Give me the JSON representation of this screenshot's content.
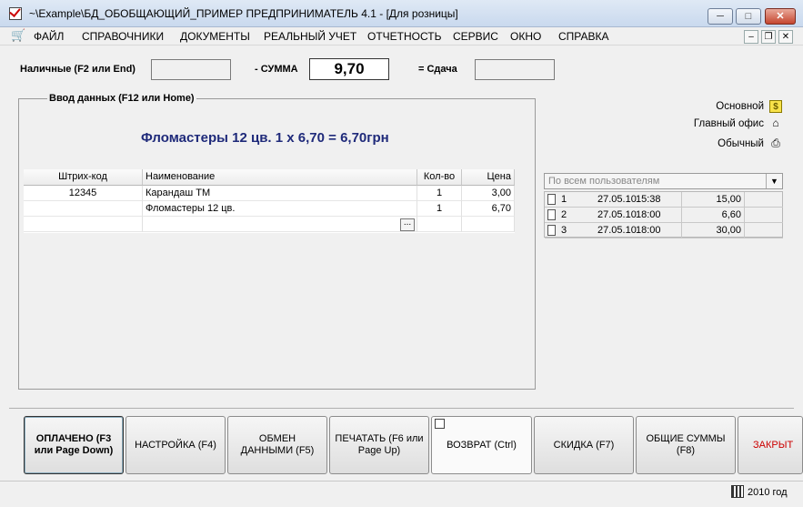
{
  "window": {
    "title": "~\\Example\\БД_ОБОБЩАЮЩИЙ_ПРИМЕР  ПРЕДПРИНИМАТЕЛЬ 4.1 - [Для розницы]",
    "minimize": "─",
    "maximize": "□",
    "close": "✕"
  },
  "menu": {
    "items": [
      "ФАЙЛ",
      "СПРАВОЧНИКИ",
      "ДОКУМЕНТЫ",
      "РЕАЛЬНЫЙ УЧЕТ",
      "ОТЧЕТНОСТЬ",
      "СЕРВИС",
      "ОКНО",
      "СПРАВКА"
    ],
    "mdi_minimize": "–",
    "mdi_restore": "❐",
    "mdi_close": "✕"
  },
  "top": {
    "cash_label": "Наличные (F2 или End)",
    "cash_value": "",
    "sum_label": "- СУММА",
    "sum_value": "9,70",
    "change_label": "= Сдача",
    "change_value": ""
  },
  "entry": {
    "group_title": "Ввод данных (F12 или Home)",
    "current_item": "Фломастеры 12 цв.   1 х 6,70 = 6,70грн",
    "columns": [
      "Штрих-код",
      "Наименование",
      "Кол-во",
      "Цена"
    ],
    "rows": [
      {
        "barcode": "12345",
        "name": "Карандаш ТМ",
        "qty": "1",
        "price": "3,00"
      },
      {
        "barcode": "",
        "name": "Фломастеры 12 цв.",
        "qty": "1",
        "price": "6,70"
      }
    ],
    "ellipsis": "..."
  },
  "side": {
    "main_label": "Основной",
    "office_label": "Главный офис",
    "regular_label": "Обычный",
    "coin_icon_glyph": "$",
    "home_icon_glyph": "⌂",
    "printer_icon_glyph": "⎙",
    "filter_value": "По всем пользователям",
    "receipts": [
      {
        "num": "1",
        "date": "27.05.10",
        "time": "15:38",
        "sum": "15,00"
      },
      {
        "num": "2",
        "date": "27.05.10",
        "time": "18:00",
        "sum": "6,60"
      },
      {
        "num": "3",
        "date": "27.05.10",
        "time": "18:00",
        "sum": "30,00"
      }
    ]
  },
  "buttons": {
    "paid": "ОПЛАЧЕНО (F3 или Page Down)",
    "settings": "НАСТРОЙКА (F4)",
    "exchange": "ОБМЕН ДАННЫМИ (F5)",
    "print": "ПЕЧАТАТЬ (F6 или Page Up)",
    "return": "ВОЗВРАТ (Ctrl)",
    "discount": "СКИДКА (F7)",
    "totals": "ОБЩИЕ СУММЫ (F8)",
    "close": "ЗАКРЫТ"
  },
  "status": {
    "year": "2010 год"
  },
  "colors": {
    "current_item_text": "#1f2a7a",
    "close_button_text": "#cc0000"
  }
}
